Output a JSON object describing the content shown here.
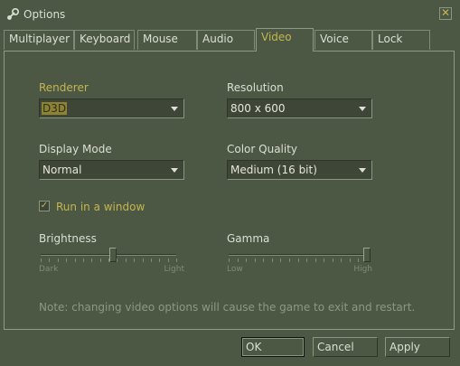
{
  "window": {
    "title": "Options",
    "close_glyph": "✕"
  },
  "tabs": [
    {
      "label": "Multiplayer"
    },
    {
      "label": "Keyboard"
    },
    {
      "label": "Mouse"
    },
    {
      "label": "Audio"
    },
    {
      "label": "Video"
    },
    {
      "label": "Voice"
    },
    {
      "label": "Lock"
    }
  ],
  "active_tab": "Video",
  "video": {
    "renderer": {
      "label": "Renderer",
      "value": "D3D"
    },
    "resolution": {
      "label": "Resolution",
      "value": "800 x 600"
    },
    "display_mode": {
      "label": "Display Mode",
      "value": "Normal"
    },
    "color_quality": {
      "label": "Color Quality",
      "value": "Medium (16 bit)"
    },
    "run_in_window": {
      "label": "Run in a window",
      "checked": true
    },
    "brightness": {
      "label": "Brightness",
      "min_label": "Dark",
      "max_label": "Light",
      "value_fraction": 0.53
    },
    "gamma": {
      "label": "Gamma",
      "min_label": "Low",
      "max_label": "High",
      "value_fraction": 1.0
    },
    "note": "Note: changing video options will cause the game to exit and restart."
  },
  "buttons": {
    "ok": "OK",
    "cancel": "Cancel",
    "apply": "Apply"
  },
  "colors": {
    "background": "#4c5844",
    "accent": "#c4b550",
    "text": "#dcdfd5"
  },
  "icons": {
    "app": "steam-icon",
    "close": "close-icon",
    "dropdown": "chevron-down-icon",
    "check": "check-icon"
  }
}
